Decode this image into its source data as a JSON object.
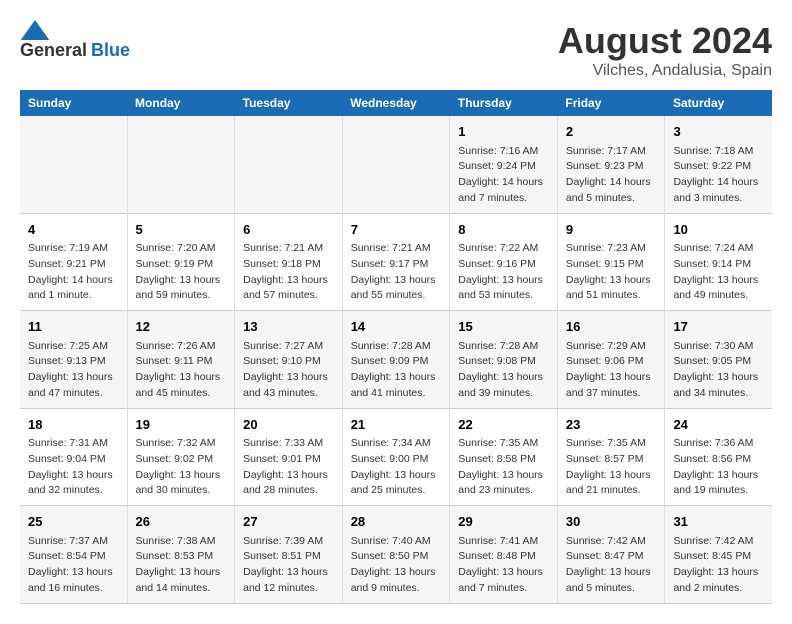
{
  "header": {
    "logo_general": "General",
    "logo_blue": "Blue",
    "title": "August 2024",
    "subtitle": "Vilches, Andalusia, Spain"
  },
  "weekdays": [
    "Sunday",
    "Monday",
    "Tuesday",
    "Wednesday",
    "Thursday",
    "Friday",
    "Saturday"
  ],
  "weeks": [
    {
      "days": [
        {
          "number": "",
          "content": ""
        },
        {
          "number": "",
          "content": ""
        },
        {
          "number": "",
          "content": ""
        },
        {
          "number": "",
          "content": ""
        },
        {
          "number": "1",
          "content": "Sunrise: 7:16 AM\nSunset: 9:24 PM\nDaylight: 14 hours\nand 7 minutes."
        },
        {
          "number": "2",
          "content": "Sunrise: 7:17 AM\nSunset: 9:23 PM\nDaylight: 14 hours\nand 5 minutes."
        },
        {
          "number": "3",
          "content": "Sunrise: 7:18 AM\nSunset: 9:22 PM\nDaylight: 14 hours\nand 3 minutes."
        }
      ]
    },
    {
      "days": [
        {
          "number": "4",
          "content": "Sunrise: 7:19 AM\nSunset: 9:21 PM\nDaylight: 14 hours\nand 1 minute."
        },
        {
          "number": "5",
          "content": "Sunrise: 7:20 AM\nSunset: 9:19 PM\nDaylight: 13 hours\nand 59 minutes."
        },
        {
          "number": "6",
          "content": "Sunrise: 7:21 AM\nSunset: 9:18 PM\nDaylight: 13 hours\nand 57 minutes."
        },
        {
          "number": "7",
          "content": "Sunrise: 7:21 AM\nSunset: 9:17 PM\nDaylight: 13 hours\nand 55 minutes."
        },
        {
          "number": "8",
          "content": "Sunrise: 7:22 AM\nSunset: 9:16 PM\nDaylight: 13 hours\nand 53 minutes."
        },
        {
          "number": "9",
          "content": "Sunrise: 7:23 AM\nSunset: 9:15 PM\nDaylight: 13 hours\nand 51 minutes."
        },
        {
          "number": "10",
          "content": "Sunrise: 7:24 AM\nSunset: 9:14 PM\nDaylight: 13 hours\nand 49 minutes."
        }
      ]
    },
    {
      "days": [
        {
          "number": "11",
          "content": "Sunrise: 7:25 AM\nSunset: 9:13 PM\nDaylight: 13 hours\nand 47 minutes."
        },
        {
          "number": "12",
          "content": "Sunrise: 7:26 AM\nSunset: 9:11 PM\nDaylight: 13 hours\nand 45 minutes."
        },
        {
          "number": "13",
          "content": "Sunrise: 7:27 AM\nSunset: 9:10 PM\nDaylight: 13 hours\nand 43 minutes."
        },
        {
          "number": "14",
          "content": "Sunrise: 7:28 AM\nSunset: 9:09 PM\nDaylight: 13 hours\nand 41 minutes."
        },
        {
          "number": "15",
          "content": "Sunrise: 7:28 AM\nSunset: 9:08 PM\nDaylight: 13 hours\nand 39 minutes."
        },
        {
          "number": "16",
          "content": "Sunrise: 7:29 AM\nSunset: 9:06 PM\nDaylight: 13 hours\nand 37 minutes."
        },
        {
          "number": "17",
          "content": "Sunrise: 7:30 AM\nSunset: 9:05 PM\nDaylight: 13 hours\nand 34 minutes."
        }
      ]
    },
    {
      "days": [
        {
          "number": "18",
          "content": "Sunrise: 7:31 AM\nSunset: 9:04 PM\nDaylight: 13 hours\nand 32 minutes."
        },
        {
          "number": "19",
          "content": "Sunrise: 7:32 AM\nSunset: 9:02 PM\nDaylight: 13 hours\nand 30 minutes."
        },
        {
          "number": "20",
          "content": "Sunrise: 7:33 AM\nSunset: 9:01 PM\nDaylight: 13 hours\nand 28 minutes."
        },
        {
          "number": "21",
          "content": "Sunrise: 7:34 AM\nSunset: 9:00 PM\nDaylight: 13 hours\nand 25 minutes."
        },
        {
          "number": "22",
          "content": "Sunrise: 7:35 AM\nSunset: 8:58 PM\nDaylight: 13 hours\nand 23 minutes."
        },
        {
          "number": "23",
          "content": "Sunrise: 7:35 AM\nSunset: 8:57 PM\nDaylight: 13 hours\nand 21 minutes."
        },
        {
          "number": "24",
          "content": "Sunrise: 7:36 AM\nSunset: 8:56 PM\nDaylight: 13 hours\nand 19 minutes."
        }
      ]
    },
    {
      "days": [
        {
          "number": "25",
          "content": "Sunrise: 7:37 AM\nSunset: 8:54 PM\nDaylight: 13 hours\nand 16 minutes."
        },
        {
          "number": "26",
          "content": "Sunrise: 7:38 AM\nSunset: 8:53 PM\nDaylight: 13 hours\nand 14 minutes."
        },
        {
          "number": "27",
          "content": "Sunrise: 7:39 AM\nSunset: 8:51 PM\nDaylight: 13 hours\nand 12 minutes."
        },
        {
          "number": "28",
          "content": "Sunrise: 7:40 AM\nSunset: 8:50 PM\nDaylight: 13 hours\nand 9 minutes."
        },
        {
          "number": "29",
          "content": "Sunrise: 7:41 AM\nSunset: 8:48 PM\nDaylight: 13 hours\nand 7 minutes."
        },
        {
          "number": "30",
          "content": "Sunrise: 7:42 AM\nSunset: 8:47 PM\nDaylight: 13 hours\nand 5 minutes."
        },
        {
          "number": "31",
          "content": "Sunrise: 7:42 AM\nSunset: 8:45 PM\nDaylight: 13 hours\nand 2 minutes."
        }
      ]
    }
  ]
}
